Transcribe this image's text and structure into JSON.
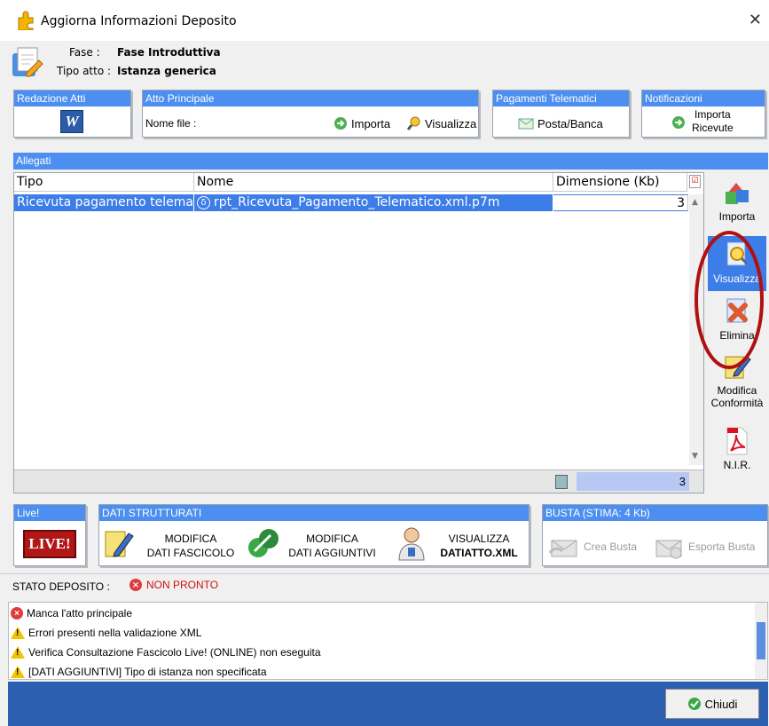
{
  "window": {
    "title": "Aggiorna Informazioni Deposito",
    "close_glyph": "✕"
  },
  "info": {
    "fase_label": "Fase :",
    "fase_value": "Fase Introduttiva",
    "tipo_label": "Tipo atto :",
    "tipo_value": "Istanza generica"
  },
  "redazione": {
    "title": "Redazione Atti",
    "icon": "word-icon"
  },
  "atto": {
    "title": "Atto Principale",
    "file_label": "Nome file :",
    "importa": "Importa",
    "visualizza": "Visualizza"
  },
  "pagamenti": {
    "title": "Pagamenti Telematici",
    "button": "Posta/Banca"
  },
  "notificazioni": {
    "title": "Notificazioni",
    "button_line1": "Importa",
    "button_line2": "Ricevute"
  },
  "allegati": {
    "title": "Allegati",
    "columns": [
      "Tipo",
      "Nome",
      "Dimensione (Kb)"
    ],
    "rows": [
      {
        "tipo": "Ricevuta pagamento telema...",
        "nome": "rpt_Ricevuta_Pagamento_Telematico.xml.p7m",
        "dim": "3"
      }
    ],
    "total": "3"
  },
  "tools": {
    "importa": "Importa",
    "visualizza": "Visualizza",
    "elimina": "Elimina",
    "modifica1": "Modifica",
    "modifica2": "Conformità",
    "nir": "N.I.R."
  },
  "live": {
    "title": "Live!",
    "logo": "LIVE!"
  },
  "dati": {
    "title": "DATI STRUTTURATI",
    "b1a": "MODIFICA",
    "b1b": "DATI FASCICOLO",
    "b2a": "MODIFICA",
    "b2b": "DATI AGGIUNTIVI",
    "b3a": "VISUALIZZA",
    "b3b": "DATIATTO.XML"
  },
  "busta": {
    "title": "BUSTA (STIMA: 4 Kb)",
    "crea": "Crea Busta",
    "esporta": "Esporta Busta"
  },
  "stato": {
    "label": "STATO DEPOSITO :",
    "value": "NON PRONTO"
  },
  "messages": [
    {
      "type": "error",
      "text": "Manca l'atto principale"
    },
    {
      "type": "warning",
      "text": "Errori presenti nella validazione XML"
    },
    {
      "type": "warning",
      "text": "Verifica Consultazione Fascicolo Live! (ONLINE) non eseguita"
    },
    {
      "type": "warning",
      "text": "[DATI AGGIUNTIVI] Tipo di istanza non specificata"
    }
  ],
  "footer": {
    "chiudi": "Chiudi"
  },
  "colors": {
    "accent": "#4d8ff0",
    "footer": "#2d5fb0",
    "highlight": "#b01010"
  }
}
